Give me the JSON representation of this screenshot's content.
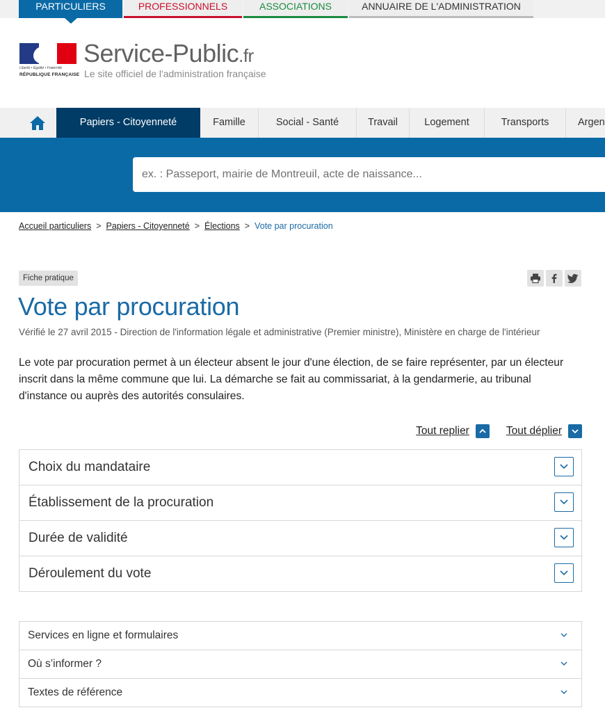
{
  "colors": {
    "brand_blue": "#0a6aa6",
    "dark_blue": "#003c66",
    "title_blue": "#1a6aa6",
    "professionnels_red": "#c8102e",
    "associations_green": "#1a8a40"
  },
  "top_tabs": [
    {
      "label": "PARTICULIERS",
      "active": true,
      "color": "#0a6aa6"
    },
    {
      "label": "PROFESSIONNELS",
      "active": false,
      "color": "#c8102e"
    },
    {
      "label": "ASSOCIATIONS",
      "active": false,
      "color": "#1a8a40"
    },
    {
      "label": "ANNUAIRE DE L'ADMINISTRATION",
      "active": false,
      "color": "#bbbbbb"
    }
  ],
  "header": {
    "logo": {
      "motto": "Liberté • Égalité • Fraternité",
      "republic": "RÉPUBLIQUE FRANÇAISE"
    },
    "site_name": "Service-Public",
    "site_tld": ".fr",
    "tagline": "Le site officiel de l'administration française"
  },
  "nav": {
    "home_icon": "home-icon",
    "items": [
      {
        "label": "Papiers - Citoyenneté",
        "active": true
      },
      {
        "label": "Famille"
      },
      {
        "label": "Social - Santé"
      },
      {
        "label": "Travail"
      },
      {
        "label": "Logement"
      },
      {
        "label": "Transports"
      },
      {
        "label": "Argent"
      }
    ]
  },
  "search": {
    "placeholder": "ex. : Passeport, mairie de Montreuil, acte de naissance..."
  },
  "breadcrumb": {
    "items": [
      "Accueil particuliers",
      "Papiers - Citoyenneté",
      "Élections"
    ],
    "separator": ">",
    "current": "Vote par procuration"
  },
  "page": {
    "badge": "Fiche pratique",
    "share_icons": [
      "print-icon",
      "facebook-icon",
      "twitter-icon"
    ],
    "title": "Vote par procuration",
    "meta": "Vérifié le 27 avril 2015 - Direction de l'information légale et administrative (Premier ministre), Ministère en charge de l'intérieur",
    "intro": "Le vote par procuration permet à un électeur absent le jour d'une élection, de se faire représenter, par un électeur inscrit dans la même commune que lui. La démarche se fait au commissariat, à la gendarmerie, au tribunal d'instance ou auprès des autorités consulaires.",
    "fold": {
      "collapse_label": "Tout replier",
      "expand_label": "Tout déplier"
    }
  },
  "accordion": [
    {
      "label": "Choix du mandataire"
    },
    {
      "label": "Établissement de la procuration"
    },
    {
      "label": "Durée de validité"
    },
    {
      "label": "Déroulement du vote"
    }
  ],
  "secondary_links": [
    {
      "label": "Services en ligne et formulaires"
    },
    {
      "label": "Où s’informer ?"
    },
    {
      "label": "Textes de référence"
    }
  ]
}
